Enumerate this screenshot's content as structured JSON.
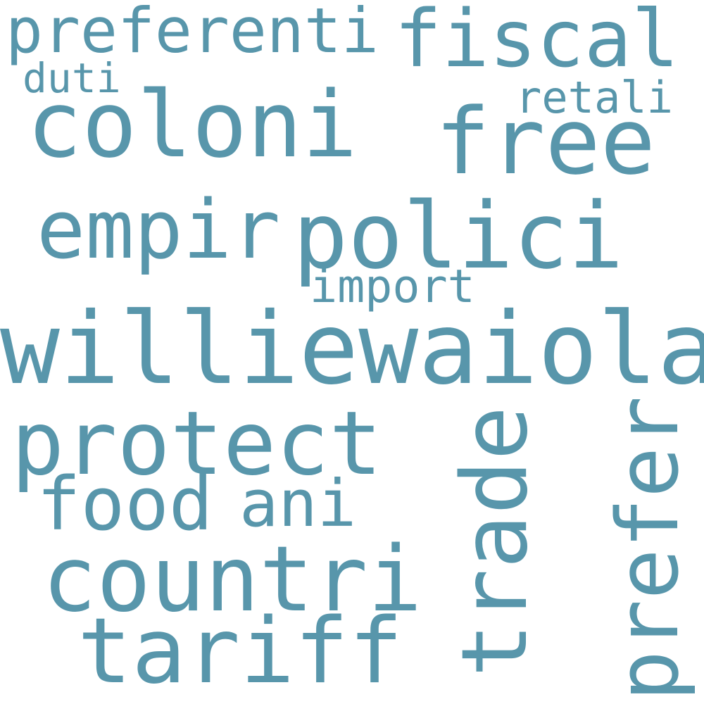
{
  "color": "#5896ab",
  "words": [
    {
      "text": "preferenti"
    },
    {
      "text": "fiscal"
    },
    {
      "text": "duti"
    },
    {
      "text": "coloni"
    },
    {
      "text": "retali"
    },
    {
      "text": "free"
    },
    {
      "text": "empir"
    },
    {
      "text": "polici"
    },
    {
      "text": "import"
    },
    {
      "text": "williewaiola"
    },
    {
      "text": "protect"
    },
    {
      "text": "trade"
    },
    {
      "text": "prefer"
    },
    {
      "text": "food"
    },
    {
      "text": "ani"
    },
    {
      "text": "countri"
    },
    {
      "text": "tariff"
    }
  ]
}
